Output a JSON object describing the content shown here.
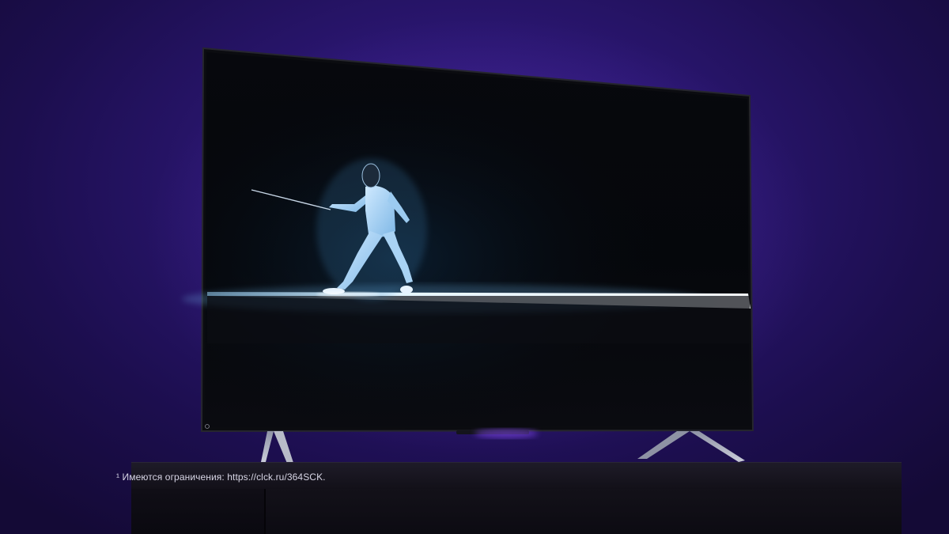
{
  "footnote": {
    "text": "¹ Имеются ограничения: https://clck.ru/364SCK."
  },
  "colors": {
    "wall": "#2a1670",
    "screen": "#06070c",
    "fencer_glow": "#bfe4ff",
    "cabinet": "#15131c",
    "ambient_led": "#8a4dff"
  },
  "icons": {
    "power_indicator": "power-indicator-icon"
  }
}
